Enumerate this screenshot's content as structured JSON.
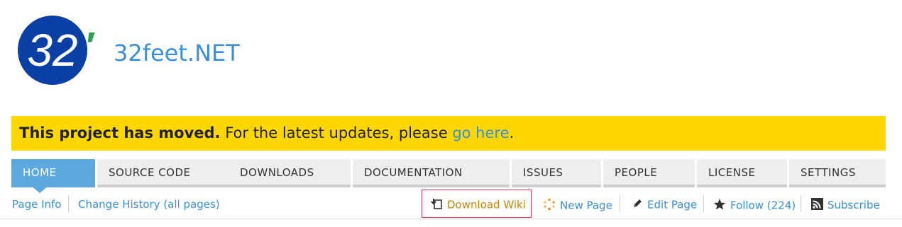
{
  "project": {
    "name": "32feet.NET",
    "logo_text": "32",
    "logo_mark": "′"
  },
  "banner": {
    "bold": "This project has moved.",
    "text": " For the latest updates, please ",
    "link": "go here",
    "end": "."
  },
  "tabs": [
    {
      "label": "HOME",
      "active": true
    },
    {
      "label": "SOURCE CODE"
    },
    {
      "label": "DOWNLOADS"
    },
    {
      "label": "DOCUMENTATION"
    },
    {
      "label": "ISSUES"
    },
    {
      "label": "PEOPLE"
    },
    {
      "label": "LICENSE"
    },
    {
      "label": "SETTINGS"
    }
  ],
  "subnav": {
    "page_info": "Page Info",
    "change_history": "Change History (all pages)",
    "download_wiki": "Download Wiki",
    "new_page": "New Page",
    "edit_page": "Edit Page",
    "follow": "Follow (224)",
    "subscribe": "Subscribe"
  },
  "colors": {
    "accent": "#3a8fd8",
    "banner": "#ffd700",
    "active_tab": "#5ea8e0",
    "highlight_border": "#d43b59",
    "download_text": "#c8860f"
  }
}
